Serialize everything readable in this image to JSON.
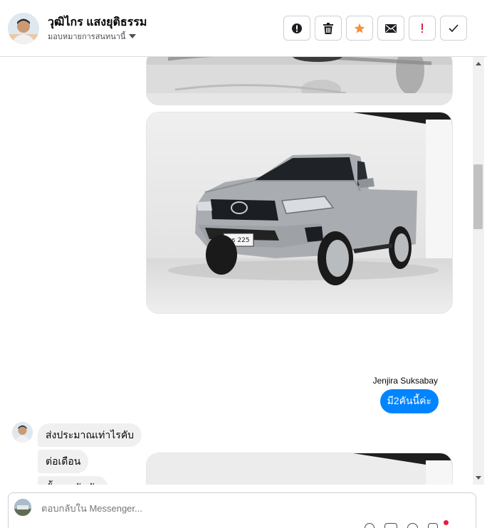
{
  "header": {
    "contact_name": "วุฒิไกร แสงยุติธรรม",
    "assign_label": "มอบหมายการสนทนานี้",
    "actions": [
      {
        "icon": "alert-circle-icon",
        "name": "mark-spam-button"
      },
      {
        "icon": "trash-icon",
        "name": "delete-button"
      },
      {
        "icon": "star-icon",
        "name": "star-button"
      },
      {
        "icon": "envelope-icon",
        "name": "mark-unread-button"
      },
      {
        "icon": "exclamation-icon",
        "name": "follow-up-button"
      },
      {
        "icon": "check-icon",
        "name": "mark-done-button"
      }
    ]
  },
  "thread": {
    "sender_name": "Jenjira Suksabay",
    "outgoing_message": "มี2คันนี้ค่ะ",
    "incoming_messages": [
      "ส่งประมาณเท่าไรคับ",
      "ต่อเดือน",
      "ทั้งสองคันคับ"
    ],
    "truck_plate": "บธ 225"
  },
  "composer": {
    "placeholder": "ตอบกลับใน Messenger..."
  },
  "colors": {
    "accent_blue": "#0084ff",
    "star_orange": "#f7923a",
    "alert_red": "#e41e3f",
    "truck_silver": "#a9adb2"
  }
}
